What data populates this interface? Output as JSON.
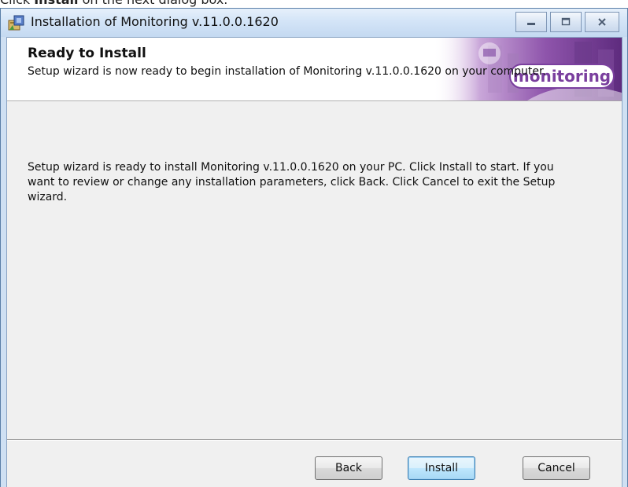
{
  "doc": {
    "prefix": "Click ",
    "bold": "Install",
    "suffix": " on the next dialog box."
  },
  "window": {
    "title": "Installation of Monitoring v.11.0.0.1620",
    "caption": {
      "minimize": "—",
      "maximize": "□",
      "close": "✕"
    }
  },
  "banner": {
    "title": "Ready to Install",
    "description": "Setup wizard is now ready to begin installation of Monitoring v.11.0.0.1620 on your computer.",
    "logo_text": "monitoring"
  },
  "body": {
    "text": "Setup wizard is ready to install Monitoring v.11.0.0.1620 on your PC. Click Install to start. If you want to review or change any installation parameters, click Back. Click Cancel to exit the Setup wizard."
  },
  "buttons": {
    "back": "Back",
    "install": "Install",
    "cancel": "Cancel"
  },
  "colors": {
    "banner_accent": "#7a3f9e",
    "default_button_border": "#3c7fb1"
  },
  "icons": {
    "app": "installer-icon",
    "minimize": "minimize-icon",
    "maximize": "maximize-icon",
    "close": "close-icon"
  }
}
